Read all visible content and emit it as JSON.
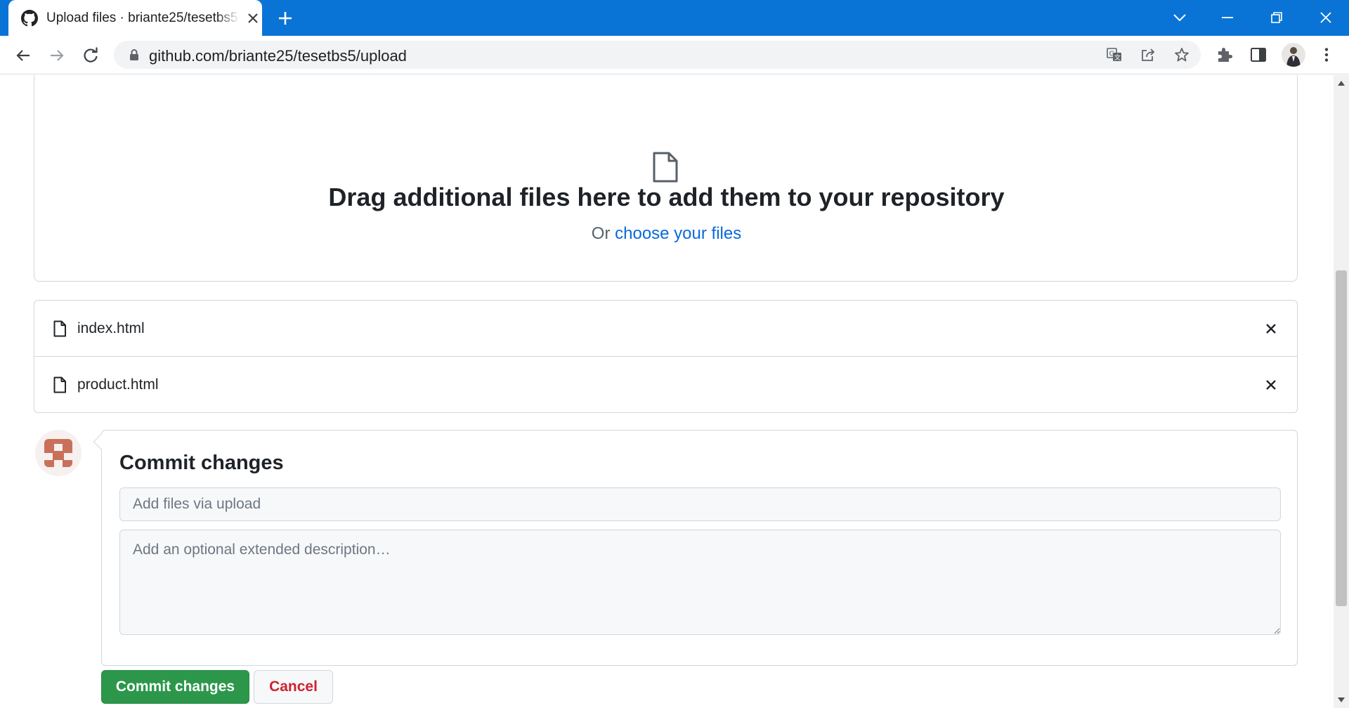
{
  "browser": {
    "tab": {
      "title": "Upload files · briante25/tesetbs5",
      "favicon": "github-icon"
    },
    "url": "github.com/briante25/tesetbs5/upload",
    "icons": [
      "back-icon",
      "forward-icon",
      "reload-icon",
      "lock-icon",
      "translate-icon",
      "share-icon",
      "star-icon",
      "extensions-icon",
      "side-panel-icon",
      "profile-avatar",
      "more-menu-icon"
    ]
  },
  "colors": {
    "chrome_blue": "#0a74d6",
    "link": "#0969da",
    "primary_button": "#2c974b",
    "danger_text": "#cf222e",
    "border": "#d0d7de"
  },
  "dropzone": {
    "title": "Drag additional files here to add them to your repository",
    "prefix": "Or",
    "link": "choose your files"
  },
  "files": [
    {
      "name": "index.html"
    },
    {
      "name": "product.html"
    }
  ],
  "commit": {
    "title": "Commit changes",
    "summary_placeholder": "Add files via upload",
    "description_placeholder": "Add an optional extended description…",
    "commit_button": "Commit changes",
    "cancel_button": "Cancel"
  }
}
